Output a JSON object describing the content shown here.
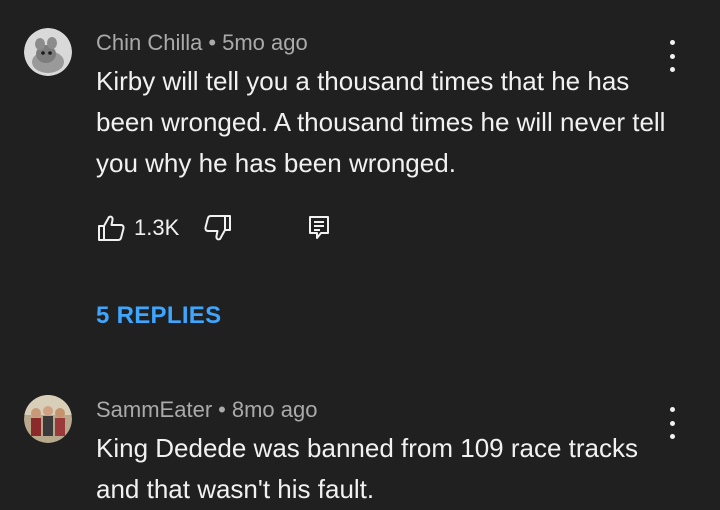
{
  "comments": [
    {
      "author": "Chin Chilla",
      "separator": "•",
      "time": "5mo ago",
      "text": "Kirby will tell you a thousand times that he has been wronged. A thousand times he will never tell you why he has been wronged.",
      "likes": "1.3K",
      "replies_label": "5 REPLIES",
      "avatar_icon": "chinchilla-avatar"
    },
    {
      "author": "SammEater",
      "separator": "•",
      "time": "8mo ago",
      "text": "King Dedede was banned from 109 race tracks and that wasn't his fault.",
      "avatar_icon": "group-photo-avatar"
    }
  ],
  "icons": {
    "like": "thumbs-up-icon",
    "dislike": "thumbs-down-icon",
    "reply": "reply-icon",
    "more": "more-vert-icon"
  },
  "colors": {
    "background": "#202020",
    "link": "#3ea6ff",
    "meta": "#aaaaaa",
    "text": "#f1f1f1"
  }
}
